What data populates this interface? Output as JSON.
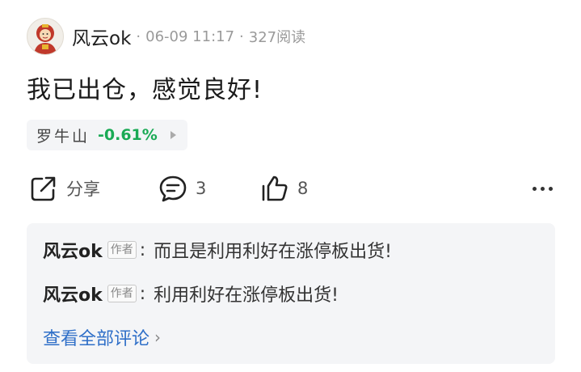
{
  "post": {
    "author": "风云ok",
    "separator": "·",
    "date": "06-09 11:17",
    "reads": "327阅读",
    "text": "我已出仓，感觉良好!"
  },
  "stock": {
    "name": "罗牛山",
    "change": "-0.61%",
    "change_color": "#1aaa55"
  },
  "actions": {
    "share_label": "分享",
    "comment_count": "3",
    "like_count": "8"
  },
  "comments": {
    "items": [
      {
        "author": "风云ok",
        "badge": "作者",
        "colon": ":",
        "text": "而且是利用利好在涨停板出货!"
      },
      {
        "author": "风云ok",
        "badge": "作者",
        "colon": ":",
        "text": "利用利好在涨停板出货!"
      }
    ],
    "view_all": "查看全部评论",
    "view_all_chevron": "›",
    "link_color": "#2f6fc8"
  },
  "icons": [
    "avatar",
    "share-icon",
    "comment-icon",
    "like-icon",
    "more-icon",
    "chevron-right-icon"
  ]
}
